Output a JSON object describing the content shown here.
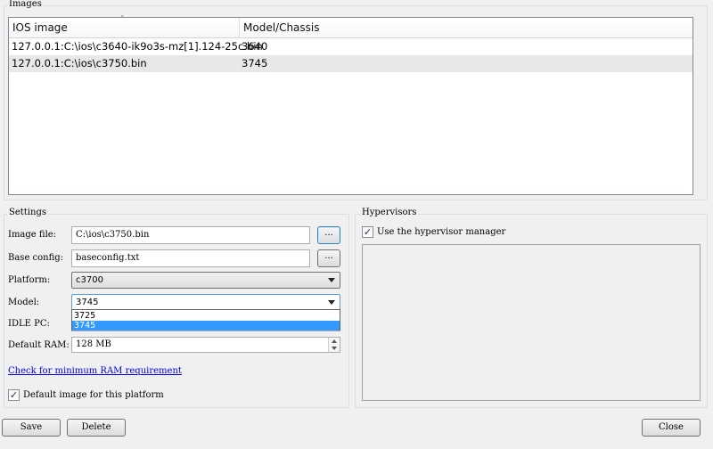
{
  "images_group": {
    "title": "Images",
    "columns": [
      "IOS image",
      "Model/Chassis"
    ],
    "rows": [
      {
        "image": "127.0.0.1:C:\\ios\\c3640-ik9o3s-mz[1].124-25c.bin",
        "model": "3640"
      },
      {
        "image": "127.0.0.1:C:\\ios\\c3750.bin",
        "model": "3745"
      }
    ],
    "sort_indicator": "˄"
  },
  "settings": {
    "title": "Settings",
    "image_file_label": "Image file:",
    "image_file_value": "C:\\ios\\c3750.bin",
    "base_config_label": "Base config:",
    "base_config_value": "baseconfig.txt",
    "browse_label": "...",
    "platform_label": "Platform:",
    "platform_value": "c3700",
    "model_label": "Model:",
    "model_value": "3745",
    "model_options": [
      "3725",
      "3745"
    ],
    "model_highlighted": "3745",
    "idle_pc_label": "IDLE PC:",
    "default_ram_label": "Default RAM:",
    "default_ram_value": "128 MB",
    "ram_link": "Check for minimum RAM requirement",
    "default_image_label": "Default image for this platform",
    "default_image_checked": true
  },
  "hypervisors": {
    "title": "Hypervisors",
    "use_manager_label": "Use the hypervisor manager",
    "use_manager_checked": true
  },
  "buttons": {
    "save": "Save",
    "delete": "Delete",
    "close": "Close"
  },
  "check_glyph": "✓",
  "colors": {
    "selection": "#3399ff",
    "selected_row": "#e8e8e8",
    "link": "#0000ee"
  }
}
